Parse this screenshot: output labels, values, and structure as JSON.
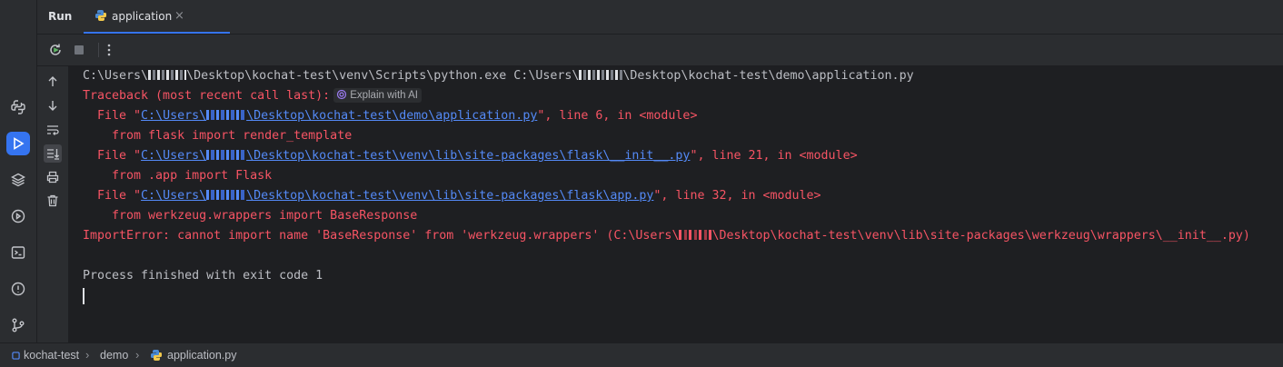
{
  "panel": {
    "title": "Run"
  },
  "tab": {
    "label": "application",
    "close": "×"
  },
  "console": {
    "cmd": {
      "a": "C:\\Users\\",
      "b": "\\Desktop\\kochat-test\\venv\\Scripts\\python.exe C:\\Users\\",
      "c": "\\Desktop\\kochat-test\\demo\\application.py"
    },
    "traceback": "Traceback (most recent call last):",
    "explain_ai": "Explain with AI",
    "frames": [
      {
        "pre": "  File \"",
        "link_a": "C:\\Users\\",
        "link_b": "\\Desktop\\kochat-test\\demo\\application.py",
        "post": "\", line 6, in <module>",
        "code": "    from flask import render_template"
      },
      {
        "pre": "  File \"",
        "link_a": "C:\\Users\\",
        "link_b": "\\Desktop\\kochat-test\\venv\\lib\\site-packages\\flask\\__init__.py",
        "post": "\", line 21, in <module>",
        "code": "    from .app import Flask"
      },
      {
        "pre": "  File \"",
        "link_a": "C:\\Users\\",
        "link_b": "\\Desktop\\kochat-test\\venv\\lib\\site-packages\\flask\\app.py",
        "post": "\", line 32, in <module>",
        "code": "    from werkzeug.wrappers import BaseResponse"
      }
    ],
    "error": {
      "a": "ImportError: cannot import name 'BaseResponse' from 'werkzeug.wrappers' (C:\\Users\\",
      "b": "\\Desktop\\kochat-test\\venv\\lib\\site-packages\\werkzeug\\wrappers\\__init__.py)"
    },
    "finished": "Process finished with exit code 1"
  },
  "statusbar": {
    "project": "kochat-test",
    "folder": "demo",
    "file": "application.py"
  },
  "colors": {
    "accent": "#3574f0",
    "error": "#f75464",
    "link": "#548af7",
    "background": "#1e1f22",
    "panel": "#2b2d30"
  }
}
